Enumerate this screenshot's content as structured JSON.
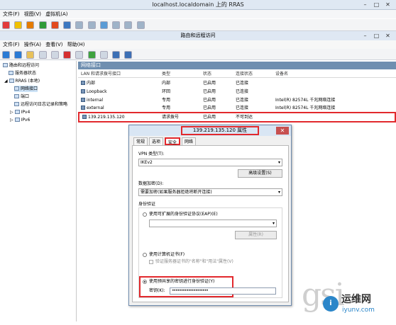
{
  "window": {
    "title": "localhost.localdomain 上的 RRAS",
    "controls": [
      "–",
      "□",
      "✕"
    ]
  },
  "vm_menu": [
    "文件(F)",
    "视图(V)",
    "虚拟机(A)"
  ],
  "mmc": {
    "title": "路由和远程访问",
    "menu": [
      "文件(F)",
      "操作(A)",
      "查看(V)",
      "帮助(H)"
    ]
  },
  "tree": {
    "root": "路由和远程访问",
    "server_status": "服务器状态",
    "server": "RRAS (本地)",
    "children": [
      "网络接口",
      "端口",
      "远程访问日志记录和策略"
    ],
    "ipv4": "IPv4",
    "ipv6": "IPv6"
  },
  "pane": {
    "header": "网络接口",
    "columns": [
      "LAN 和请求拨号接口",
      "类型",
      "状态",
      "连接状态",
      "设备名"
    ],
    "rows": [
      {
        "name": "内部",
        "type": "内部",
        "status": "已启用",
        "conn": "已连接",
        "device": ""
      },
      {
        "name": "Loopback",
        "type": "环回",
        "status": "已启用",
        "conn": "已连接",
        "device": ""
      },
      {
        "name": "internal",
        "type": "专用",
        "status": "已启用",
        "conn": "已连接",
        "device": "Intel(R) 82574L 千兆网络连接"
      },
      {
        "name": "external",
        "type": "专用",
        "status": "已启用",
        "conn": "已连接",
        "device": "Intel(R) 82574L 千兆网络连接"
      },
      {
        "name": "139.219.135.120",
        "type": "请求拨号",
        "status": "已启用",
        "conn": "不可到达",
        "device": ""
      }
    ]
  },
  "dialog": {
    "title": "139.219.135.120 属性",
    "tabs": [
      "常规",
      "选项",
      "安全",
      "网络"
    ],
    "vpn_type_label": "VPN 类型(T):",
    "vpn_type_value": "IKEv2",
    "advanced_button": "高级设置(S)",
    "encryption_label": "数据加密(D):",
    "encryption_value": "需要加密(如果服务器拒绝将断开连接)",
    "auth_group": "身份验证",
    "eap_radio": "使用可扩展的身份验证协议(EAP)(E)",
    "properties_button": "属性(R)",
    "cert_radio": "使用计算机证书(F)",
    "cert_check": "验证服务器证书的\"名称\"和\"用法\"属性(V)",
    "psk_radio": "使用预共享的密钥进行身份验证(Y)",
    "key_label": "密钥(K):",
    "key_value": "••••••••••••••••••••"
  },
  "watermark": {
    "text": "gsi",
    "logo": "i",
    "cn": "运维网",
    "site": "iyunv.com"
  }
}
